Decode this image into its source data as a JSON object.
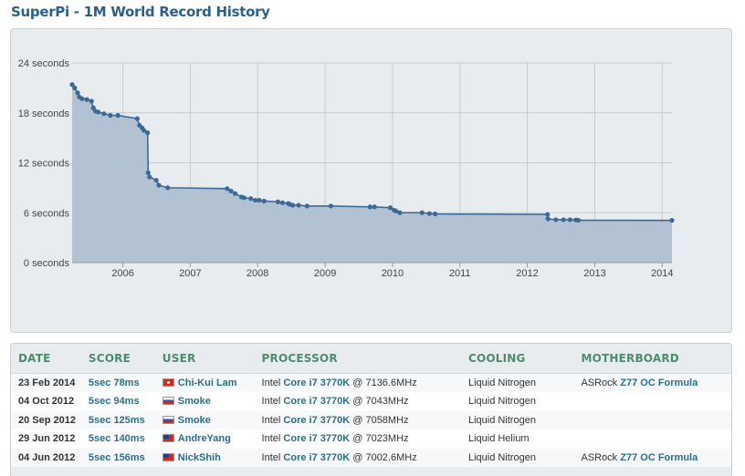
{
  "page": {
    "title": "SuperPi - 1M World Record History"
  },
  "chart_data": {
    "type": "area",
    "title": "",
    "xlabel": "",
    "ylabel": "",
    "xlim": [
      "2005-04-01",
      "2014-02-23"
    ],
    "ylim": [
      0,
      24
    ],
    "y_ticks": [
      0,
      6,
      12,
      18,
      24
    ],
    "y_tick_labels": [
      "0 seconds",
      "6 seconds",
      "12 seconds",
      "18 seconds",
      "24 seconds"
    ],
    "x_tick_labels": [
      "2006",
      "2007",
      "2008",
      "2009",
      "2010",
      "2011",
      "2012",
      "2013",
      "2014"
    ],
    "grid": true,
    "legend": "none",
    "line_color": "#3c6a96",
    "fill_color": "#afc0d0",
    "series": [
      {
        "x": [
          "2005-04-01",
          "2005-04-15",
          "2005-05-01",
          "2005-05-10",
          "2005-05-25",
          "2005-06-20",
          "2005-07-15",
          "2005-07-25",
          "2005-08-05",
          "2005-08-20",
          "2005-09-20",
          "2005-10-25",
          "2005-12-05",
          "2006-03-20",
          "2006-04-01",
          "2006-04-15",
          "2006-04-25",
          "2006-05-15",
          "2006-05-18",
          "2006-05-25",
          "2006-07-01",
          "2006-07-15",
          "2006-09-01",
          "2007-07-20",
          "2007-08-10",
          "2007-09-01",
          "2007-10-05",
          "2007-10-20",
          "2007-11-25",
          "2007-12-20",
          "2008-01-10",
          "2008-02-05",
          "2008-04-20",
          "2008-05-15",
          "2008-06-15",
          "2008-06-25",
          "2008-07-10",
          "2008-08-10",
          "2008-09-25",
          "2009-02-01",
          "2009-09-01",
          "2009-09-25",
          "2009-12-20",
          "2010-01-10",
          "2010-01-20",
          "2010-02-10",
          "2010-06-10",
          "2010-07-20",
          "2010-08-20",
          "2012-04-20",
          "2012-04-22",
          "2012-06-04",
          "2012-07-15",
          "2012-08-20",
          "2012-09-20",
          "2012-10-04",
          "2014-02-23"
        ],
        "y": [
          21.4,
          21.0,
          20.4,
          19.9,
          19.7,
          19.6,
          19.4,
          18.6,
          18.2,
          18.1,
          17.9,
          17.7,
          17.7,
          17.3,
          16.5,
          16.2,
          15.9,
          15.6,
          10.8,
          10.3,
          9.9,
          9.3,
          9.0,
          8.9,
          8.6,
          8.3,
          7.9,
          7.8,
          7.7,
          7.5,
          7.5,
          7.4,
          7.3,
          7.2,
          7.1,
          7.0,
          6.9,
          6.9,
          6.8,
          6.8,
          6.7,
          6.7,
          6.6,
          6.3,
          6.2,
          6.0,
          6.0,
          5.9,
          5.85,
          5.79,
          5.26,
          5.16,
          5.16,
          5.16,
          5.13,
          5.09,
          5.08
        ]
      }
    ]
  },
  "table": {
    "headers": [
      "DATE",
      "SCORE",
      "USER",
      "PROCESSOR",
      "COOLING",
      "MOTHERBOARD"
    ],
    "rows": [
      {
        "date": "23 Feb 2014",
        "score": "5sec 78ms",
        "user": "Chi-Kui Lam",
        "flag": "hk",
        "proc_brand": "Intel",
        "proc_model": "Core i7 3770K",
        "proc_freq": "@ 7136.6MHz",
        "cooling": "Liquid Nitrogen",
        "mb_brand": "ASRock",
        "mb_model": "Z77 OC Formula"
      },
      {
        "date": "04 Oct 2012",
        "score": "5sec 94ms",
        "user": "Smoke",
        "flag": "ru",
        "proc_brand": "Intel",
        "proc_model": "Core i7 3770K",
        "proc_freq": "@ 7043MHz",
        "cooling": "Liquid Nitrogen",
        "mb_brand": "",
        "mb_model": ""
      },
      {
        "date": "20 Sep 2012",
        "score": "5sec 125ms",
        "user": "Smoke",
        "flag": "ru",
        "proc_brand": "Intel",
        "proc_model": "Core i7 3770K",
        "proc_freq": "@ 7058MHz",
        "cooling": "Liquid Nitrogen",
        "mb_brand": "",
        "mb_model": ""
      },
      {
        "date": "29 Jun 2012",
        "score": "5sec 140ms",
        "user": "AndreYang",
        "flag": "tw",
        "proc_brand": "Intel",
        "proc_model": "Core i7 3770K",
        "proc_freq": "@ 7023MHz",
        "cooling": "Liquid Helium",
        "mb_brand": "",
        "mb_model": ""
      },
      {
        "date": "04 Jun 2012",
        "score": "5sec 156ms",
        "user": "NickShih",
        "flag": "tw",
        "proc_brand": "Intel",
        "proc_model": "Core i7 3770K",
        "proc_freq": "@ 7002.6MHz",
        "cooling": "Liquid Nitrogen",
        "mb_brand": "ASRock",
        "mb_model": "Z77 OC Formula"
      }
    ]
  }
}
